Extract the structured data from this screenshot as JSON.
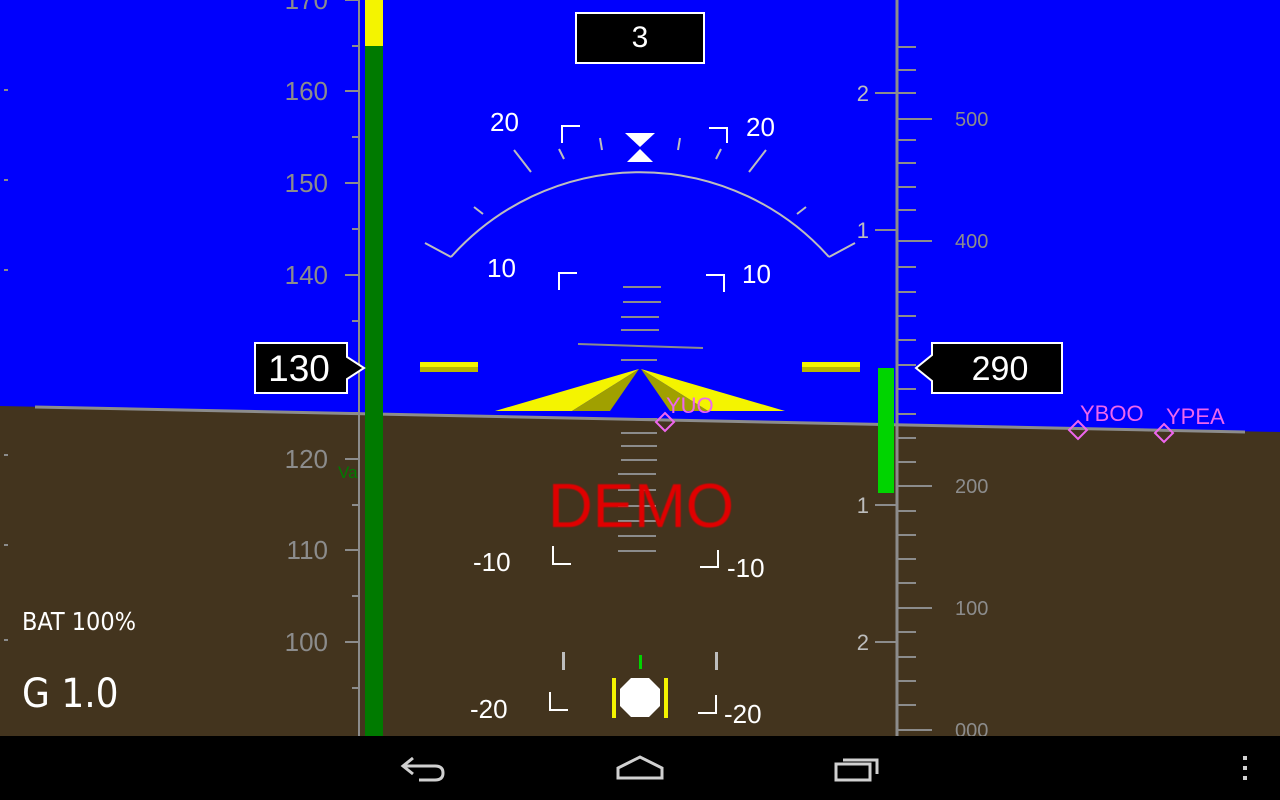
{
  "colors": {
    "sky": "#0000fd",
    "ground": "#43341e",
    "horizon": "#8c8c8c",
    "tape_text": "#8c8c8c",
    "speed_green": "#007a00",
    "speed_yellow": "#f4f400",
    "waypoint": "#ee66ee",
    "demo_text": "#e00000",
    "vsi_green": "#00d400"
  },
  "airspeed": {
    "current": "130",
    "ticks": [
      "170",
      "160",
      "150",
      "140",
      "120",
      "110",
      "100"
    ],
    "va_label": "Va"
  },
  "altitude": {
    "current": "290",
    "ticks": [
      "500",
      "400",
      "200",
      "100",
      "000"
    ]
  },
  "vertical_speed": {
    "ticks": [
      "2",
      "1",
      "1",
      "2"
    ]
  },
  "heading_box": "3",
  "pitch_labels": {
    "up20_left": "20",
    "up20_right": "20",
    "up10_left": "10",
    "up10_right": "10",
    "down10_left": "-10",
    "down10_right": "-10",
    "down20_left": "-20",
    "down20_right": "-20"
  },
  "waypoints": [
    "YUO",
    "YBOO",
    "YPEA"
  ],
  "demo_label": "DEMO",
  "status": {
    "battery": "BAT 100%",
    "g_load": "G 1.0"
  },
  "nav": {
    "back": "back-icon",
    "home": "home-icon",
    "recents": "recent-apps-icon",
    "menu": "menu-overflow-icon"
  }
}
